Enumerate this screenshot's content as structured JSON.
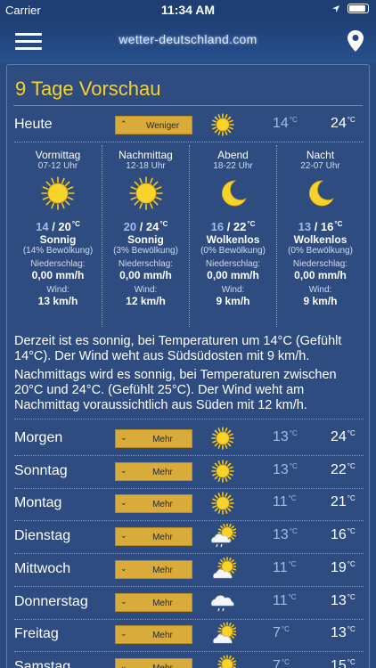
{
  "status": {
    "carrier": "Carrier",
    "time": "11:34 AM"
  },
  "nav": {
    "logo": "wetter-deutschland.com"
  },
  "title": "9 Tage Vorschau",
  "today": {
    "day": "Heute",
    "button": "Weniger",
    "icon": "sun-icon",
    "tmin": "14",
    "tmax": "24",
    "parts": [
      {
        "name": "Vormittag",
        "range": "07-12 Uhr",
        "icon": "sun-icon",
        "lo": "14",
        "hi": "20",
        "desc": "Sonnig",
        "cloud": "(14% Bewölkung)",
        "rain_label": "Niederschlag:",
        "rain": "0,00 mm/h",
        "wind_label": "Wind:",
        "wind": "13 km/h"
      },
      {
        "name": "Nachmittag",
        "range": "12-18 Uhr",
        "icon": "sun-icon",
        "lo": "20",
        "hi": "24",
        "desc": "Sonnig",
        "cloud": "(3% Bewölkung)",
        "rain_label": "Niederschlag:",
        "rain": "0,00 mm/h",
        "wind_label": "Wind:",
        "wind": "12 km/h"
      },
      {
        "name": "Abend",
        "range": "18-22 Uhr",
        "icon": "moon-icon",
        "lo": "16",
        "hi": "22",
        "desc": "Wolkenlos",
        "cloud": "(0% Bewölkung)",
        "rain_label": "Niederschlag:",
        "rain": "0,00 mm/h",
        "wind_label": "Wind:",
        "wind": "9 km/h"
      },
      {
        "name": "Nacht",
        "range": "22-07 Uhr",
        "icon": "moon-icon",
        "lo": "13",
        "hi": "16",
        "desc": "Wolkenlos",
        "cloud": "(0% Bewölkung)",
        "rain_label": "Niederschlag:",
        "rain": "0,00 mm/h",
        "wind_label": "Wind:",
        "wind": "9 km/h"
      }
    ],
    "text1": "Derzeit ist es sonnig, bei Temperaturen um 14°C (Gefühlt 14°C). Der Wind weht aus Südsüdosten mit 9 km/h.",
    "text2": "Nachmittags wird es sonnig, bei Temperaturen zwischen 20°C und 24°C. (Gefühlt 25°C). Der Wind weht am Nachmittag voraussichtlich aus Süden mit 12 km/h."
  },
  "deg_unit": "°C",
  "days": [
    {
      "day": "Morgen",
      "button": "Mehr",
      "icon": "sun-icon",
      "tmin": "13",
      "tmax": "24"
    },
    {
      "day": "Sonntag",
      "button": "Mehr",
      "icon": "sun-icon",
      "tmin": "13",
      "tmax": "22"
    },
    {
      "day": "Montag",
      "button": "Mehr",
      "icon": "sun-icon",
      "tmin": "11",
      "tmax": "21"
    },
    {
      "day": "Dienstag",
      "button": "Mehr",
      "icon": "sun-cloud-rain-icon",
      "tmin": "13",
      "tmax": "16"
    },
    {
      "day": "Mittwoch",
      "button": "Mehr",
      "icon": "sun-cloud-icon",
      "tmin": "11",
      "tmax": "19"
    },
    {
      "day": "Donnerstag",
      "button": "Mehr",
      "icon": "cloud-rain-icon",
      "tmin": "11",
      "tmax": "13"
    },
    {
      "day": "Freitag",
      "button": "Mehr",
      "icon": "sun-cloud-icon",
      "tmin": "7",
      "tmax": "13"
    },
    {
      "day": "Samstag",
      "button": "Mehr",
      "icon": "sun-cloud-icon",
      "tmin": "7",
      "tmax": "15"
    }
  ]
}
